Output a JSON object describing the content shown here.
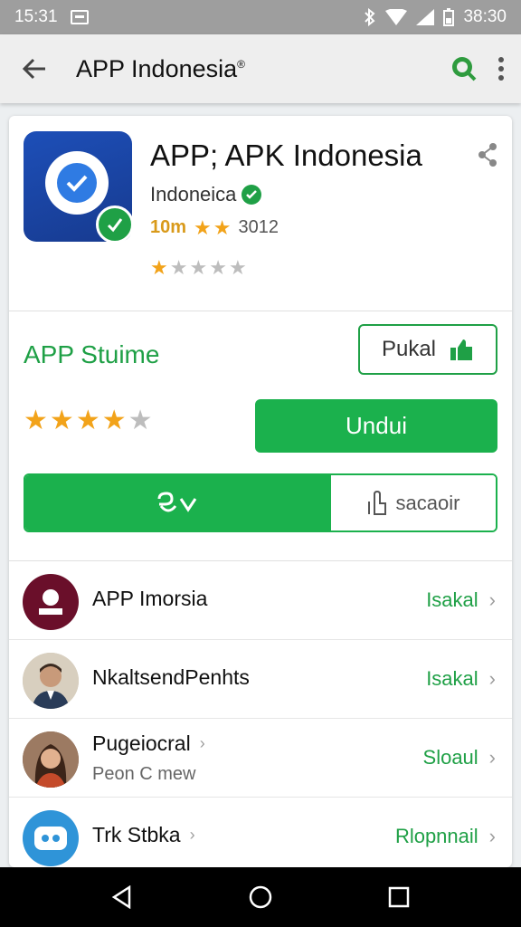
{
  "status_bar": {
    "time_left": "15:31",
    "time_right": "38:30"
  },
  "app_bar": {
    "title": "APP Indonesia",
    "title_mark": "®"
  },
  "app": {
    "title": "APP; APK Indonesia",
    "developer": "Indoneica",
    "downloads": "10m",
    "review_count": "3012",
    "meta_rating": 2,
    "small_rating": 1,
    "icon_color": "#1d4fb8",
    "badge_color": "#1fa046"
  },
  "actions": {
    "section_label": "APP Stuime",
    "outline_button": "Pukal",
    "big_rating": 4,
    "primary_button": "Undui",
    "split_right_label": "sacaoir"
  },
  "colors": {
    "accent": "#1bb14d",
    "star": "#f2a31a"
  },
  "list": [
    {
      "title": "APP Imorsia",
      "subtitle": "",
      "action": "Isakal",
      "avatar": "user-icon"
    },
    {
      "title": "NkaltsendPenhts",
      "subtitle": "",
      "action": "Isakal",
      "avatar": "man-photo"
    },
    {
      "title": "Pugeiocral",
      "subtitle": "Peon C mew",
      "action": "Sloaul",
      "avatar": "woman-photo"
    },
    {
      "title": "Trk Stbka",
      "subtitle": "",
      "action": "Rlopnnail",
      "avatar": "robot-icon"
    }
  ]
}
